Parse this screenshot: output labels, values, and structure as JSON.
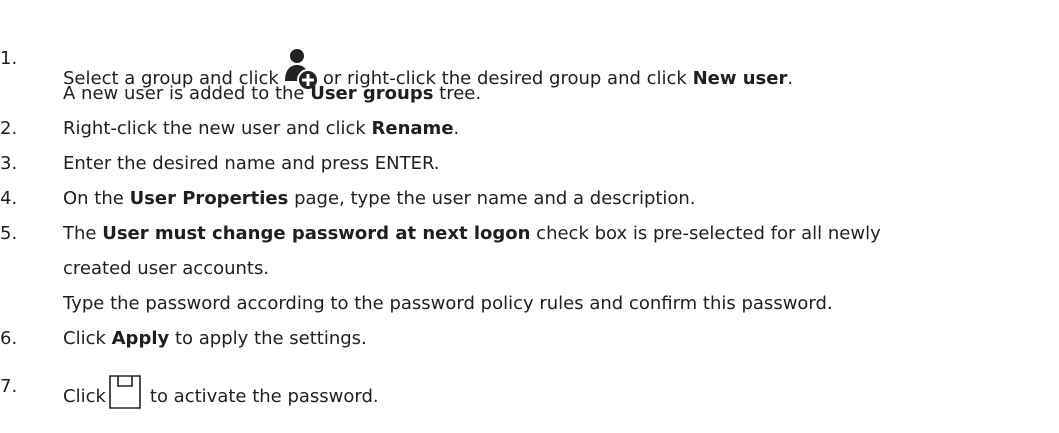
{
  "steps": [
    {
      "number": "1.",
      "lines": [
        {
          "segments": [
            {
              "text": "Select a group and click",
              "bold": false
            },
            {
              "icon": "user-add-icon"
            },
            {
              "text": "or right-click the desired group and click ",
              "bold": false
            },
            {
              "text": "New user",
              "bold": true
            },
            {
              "text": ".",
              "bold": false
            }
          ]
        },
        {
          "segments": [
            {
              "text": "A new user is added to the ",
              "bold": false
            },
            {
              "text": "User groups",
              "bold": true
            },
            {
              "text": " tree.",
              "bold": false
            }
          ]
        }
      ]
    },
    {
      "number": "2.",
      "lines": [
        {
          "segments": [
            {
              "text": "Right-click the new user and click ",
              "bold": false
            },
            {
              "text": "Rename",
              "bold": true
            },
            {
              "text": ".",
              "bold": false
            }
          ]
        }
      ]
    },
    {
      "number": "3.",
      "lines": [
        {
          "segments": [
            {
              "text": "Enter the desired name and press ENTER.",
              "bold": false
            }
          ]
        }
      ]
    },
    {
      "number": "4.",
      "lines": [
        {
          "segments": [
            {
              "text": "On the ",
              "bold": false
            },
            {
              "text": "User Properties",
              "bold": true
            },
            {
              "text": " page, type the user name and a description.",
              "bold": false
            }
          ]
        }
      ]
    },
    {
      "number": "5.",
      "lines": [
        {
          "segments": [
            {
              "text": "The ",
              "bold": false
            },
            {
              "text": "User must change password at next logon",
              "bold": true
            },
            {
              "text": " check box is pre-selected for all newly",
              "bold": false
            }
          ]
        },
        {
          "segments": [
            {
              "text": "created user accounts.",
              "bold": false
            }
          ]
        },
        {
          "segments": [
            {
              "text": "Type the password according to the password policy rules and confirm this password.",
              "bold": false
            }
          ]
        }
      ]
    },
    {
      "number": "6.",
      "lines": [
        {
          "segments": [
            {
              "text": "Click ",
              "bold": false
            },
            {
              "text": "Apply",
              "bold": true
            },
            {
              "text": " to apply the settings.",
              "bold": false
            }
          ]
        }
      ]
    },
    {
      "number": "7.",
      "lines": [
        {
          "segments": [
            {
              "text": "Click",
              "bold": false
            },
            {
              "icon": "save-icon"
            },
            {
              "text": "to activate the password.",
              "bold": false
            }
          ]
        }
      ]
    }
  ]
}
